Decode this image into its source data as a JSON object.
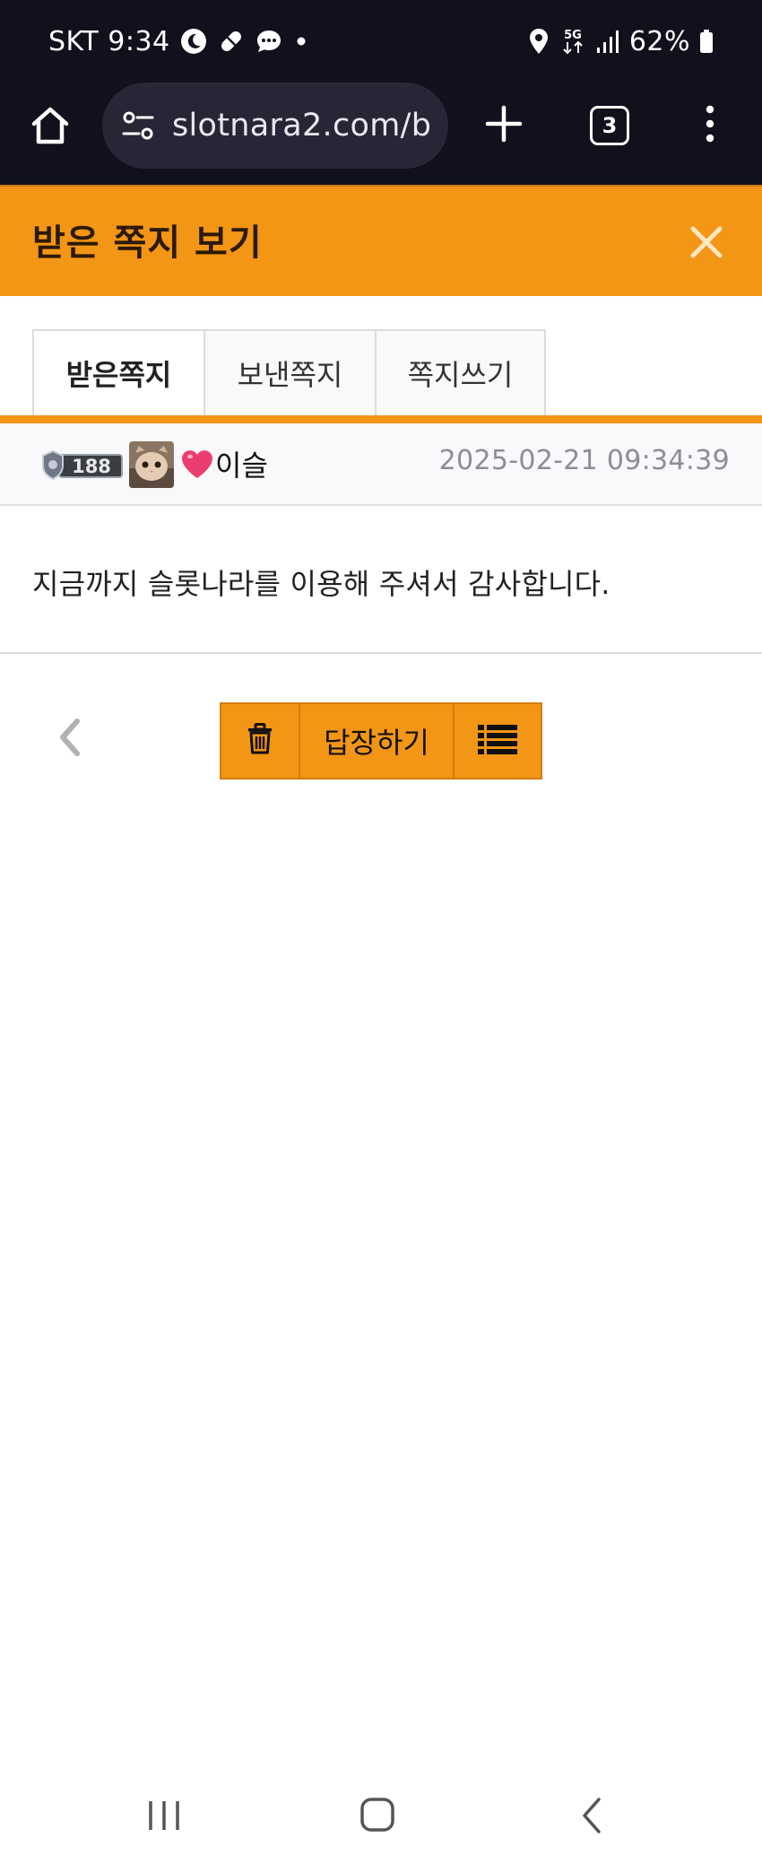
{
  "status_bar": {
    "carrier_time": "SKT 9:34",
    "network": "5G",
    "battery": "62%",
    "icons": [
      "moon-icon",
      "pill-icon",
      "chat-bubble-icon",
      "dot-icon",
      "location-icon",
      "signal-icon",
      "battery-icon"
    ]
  },
  "browser": {
    "url": "slotnara2.com/b",
    "tab_count": "3",
    "icons": [
      "home-icon",
      "tune-icon",
      "plus-icon",
      "more-vert-icon"
    ]
  },
  "header": {
    "title": "받은 쪽지 보기",
    "close_icon": "close-icon"
  },
  "tabs": [
    {
      "label": "받은쪽지",
      "active": true
    },
    {
      "label": "보낸쪽지",
      "active": false
    },
    {
      "label": "쪽지쓰기",
      "active": false
    }
  ],
  "message": {
    "level": "188",
    "sender": "이슬",
    "date": "2025-02-21 09:34:39",
    "body": "지금까지 슬롯나라를 이용해 주셔서 감사합니다."
  },
  "actions": {
    "reply_label": "답장하기",
    "icons": [
      "trash-icon",
      "list-icon",
      "chevron-left-icon"
    ]
  },
  "colors": {
    "accent": "#f39515",
    "system_bar": "#11111d",
    "url_box": "#262636",
    "date_text": "#8d8d93"
  }
}
